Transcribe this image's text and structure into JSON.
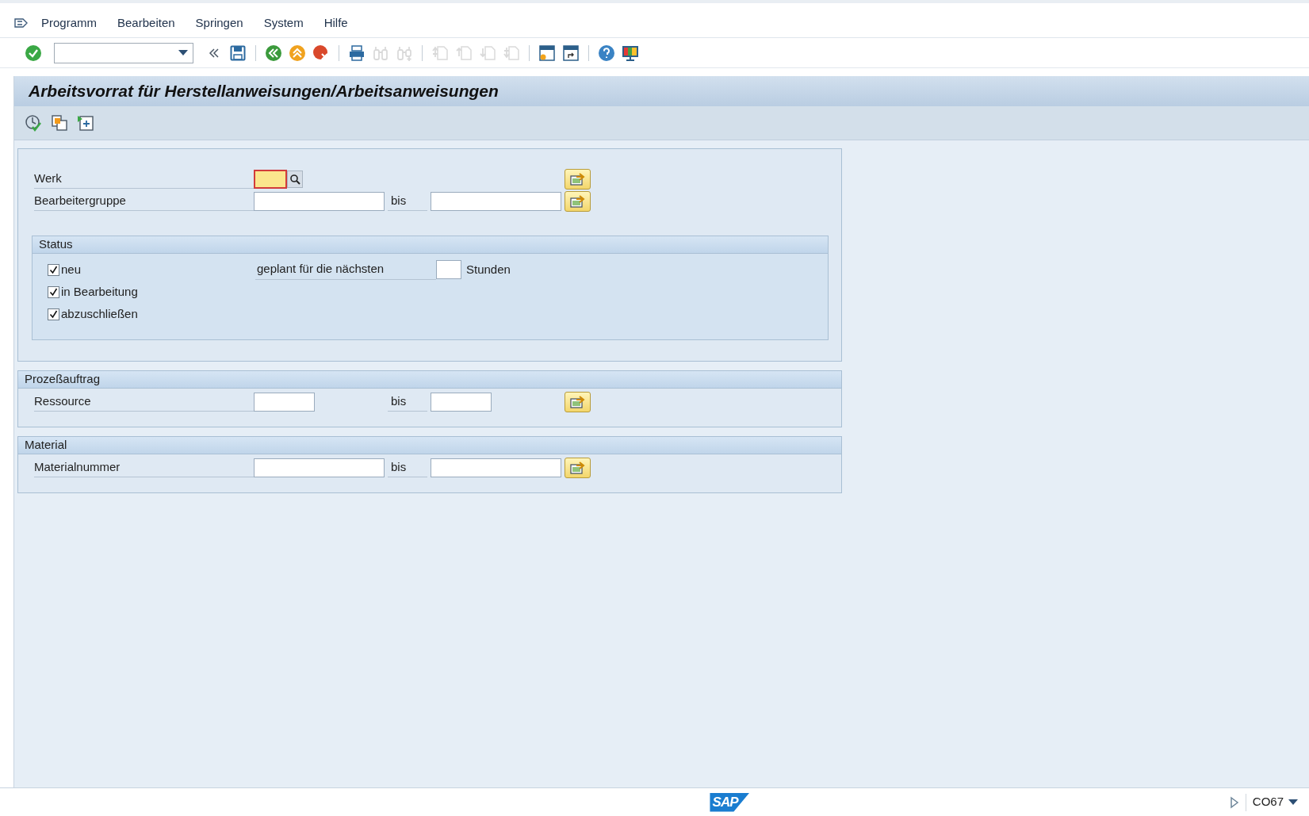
{
  "menu": [
    "Programm",
    "Bearbeiten",
    "Springen",
    "System",
    "Hilfe"
  ],
  "toolbar": [
    {
      "kind": "enter",
      "disabled": false
    },
    {
      "kind": "command_field",
      "disabled": false
    },
    {
      "kind": "collapse",
      "disabled": false
    },
    {
      "kind": "save",
      "disabled": false
    },
    {
      "kind": "separator",
      "disabled": false
    },
    {
      "kind": "back",
      "disabled": false
    },
    {
      "kind": "exit",
      "disabled": false
    },
    {
      "kind": "cancel",
      "disabled": false
    },
    {
      "kind": "separator",
      "disabled": false
    },
    {
      "kind": "print",
      "disabled": false
    },
    {
      "kind": "find",
      "disabled": true
    },
    {
      "kind": "find_next",
      "disabled": true
    },
    {
      "kind": "separator",
      "disabled": false
    },
    {
      "kind": "first_page",
      "disabled": true
    },
    {
      "kind": "prev_page",
      "disabled": true
    },
    {
      "kind": "next_page",
      "disabled": true
    },
    {
      "kind": "last_page",
      "disabled": true
    },
    {
      "kind": "separator",
      "disabled": false
    },
    {
      "kind": "new_session",
      "disabled": false
    },
    {
      "kind": "shortcut",
      "disabled": false
    },
    {
      "kind": "separator",
      "disabled": false
    },
    {
      "kind": "help",
      "disabled": false
    },
    {
      "kind": "layout",
      "disabled": false
    }
  ],
  "title": "Arbeitsvorrat für Herstellanweisungen/Arbeitsanweisungen",
  "app_toolbar": [
    {
      "kind": "execute"
    },
    {
      "kind": "get_variant"
    },
    {
      "kind": "selection_options"
    }
  ],
  "selection": {
    "rows": [
      {
        "label": "Werk",
        "kind": "single",
        "focused": true
      },
      {
        "label": "Bearbeitergruppe",
        "kind": "range",
        "to_label": "bis",
        "focused": false
      }
    ],
    "status": {
      "title": "Status",
      "checkboxes": [
        {
          "label": "neu",
          "checked": true
        },
        {
          "label": "in Bearbeitung",
          "checked": true
        },
        {
          "label": "abzuschließen",
          "checked": true
        }
      ],
      "planned": {
        "label": "geplant für die nächsten",
        "unit": "Stunden"
      }
    }
  },
  "sections": [
    {
      "title": "Prozeßauftrag",
      "rows": [
        {
          "label": "Ressource",
          "kind": "range_short",
          "to_label": "bis",
          "focused": false
        }
      ]
    },
    {
      "title": "Material",
      "rows": [
        {
          "label": "Materialnummer",
          "kind": "range",
          "to_label": "bis",
          "focused": false
        }
      ]
    }
  ],
  "status_bar": {
    "logo": "SAP",
    "transaction": "CO67"
  }
}
